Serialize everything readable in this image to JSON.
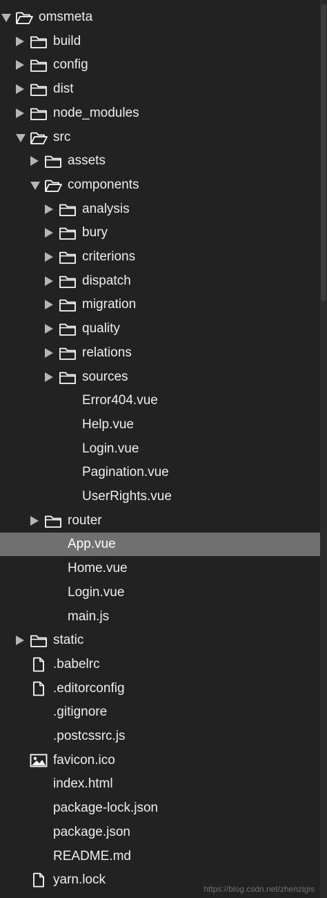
{
  "colors": {
    "background": "#222222",
    "text": "#eeeeee",
    "selection": "#707070",
    "arrow": "#b5b5b5",
    "icon": "#ffffff"
  },
  "tree": [
    {
      "label": "omsmeta",
      "depth": 0,
      "kind": "folder",
      "state": "expanded"
    },
    {
      "label": "build",
      "depth": 1,
      "kind": "folder",
      "state": "collapsed"
    },
    {
      "label": "config",
      "depth": 1,
      "kind": "folder",
      "state": "collapsed"
    },
    {
      "label": "dist",
      "depth": 1,
      "kind": "folder",
      "state": "collapsed"
    },
    {
      "label": "node_modules",
      "depth": 1,
      "kind": "folder",
      "state": "collapsed"
    },
    {
      "label": "src",
      "depth": 1,
      "kind": "folder",
      "state": "expanded"
    },
    {
      "label": "assets",
      "depth": 2,
      "kind": "folder",
      "state": "collapsed"
    },
    {
      "label": "components",
      "depth": 2,
      "kind": "folder",
      "state": "expanded"
    },
    {
      "label": "analysis",
      "depth": 3,
      "kind": "folder",
      "state": "collapsed"
    },
    {
      "label": "bury",
      "depth": 3,
      "kind": "folder",
      "state": "collapsed"
    },
    {
      "label": "criterions",
      "depth": 3,
      "kind": "folder",
      "state": "collapsed"
    },
    {
      "label": "dispatch",
      "depth": 3,
      "kind": "folder",
      "state": "collapsed"
    },
    {
      "label": "migration",
      "depth": 3,
      "kind": "folder",
      "state": "collapsed"
    },
    {
      "label": "quality",
      "depth": 3,
      "kind": "folder",
      "state": "collapsed"
    },
    {
      "label": "relations",
      "depth": 3,
      "kind": "folder",
      "state": "collapsed"
    },
    {
      "label": "sources",
      "depth": 3,
      "kind": "folder",
      "state": "collapsed"
    },
    {
      "label": "Error404.vue",
      "depth": 3,
      "kind": "file",
      "icon": "none"
    },
    {
      "label": "Help.vue",
      "depth": 3,
      "kind": "file",
      "icon": "none"
    },
    {
      "label": "Login.vue",
      "depth": 3,
      "kind": "file",
      "icon": "none"
    },
    {
      "label": "Pagination.vue",
      "depth": 3,
      "kind": "file",
      "icon": "none"
    },
    {
      "label": "UserRights.vue",
      "depth": 3,
      "kind": "file",
      "icon": "none"
    },
    {
      "label": "router",
      "depth": 2,
      "kind": "folder",
      "state": "collapsed"
    },
    {
      "label": "App.vue",
      "depth": 2,
      "kind": "file",
      "icon": "none",
      "selected": true
    },
    {
      "label": "Home.vue",
      "depth": 2,
      "kind": "file",
      "icon": "none"
    },
    {
      "label": "Login.vue",
      "depth": 2,
      "kind": "file",
      "icon": "none"
    },
    {
      "label": "main.js",
      "depth": 2,
      "kind": "file",
      "icon": "none"
    },
    {
      "label": "static",
      "depth": 1,
      "kind": "folder",
      "state": "collapsed"
    },
    {
      "label": ".babelrc",
      "depth": 1,
      "kind": "file",
      "icon": "document-icon"
    },
    {
      "label": ".editorconfig",
      "depth": 1,
      "kind": "file",
      "icon": "document-icon"
    },
    {
      "label": ".gitignore",
      "depth": 1,
      "kind": "file",
      "icon": "none"
    },
    {
      "label": ".postcssrc.js",
      "depth": 1,
      "kind": "file",
      "icon": "none"
    },
    {
      "label": "favicon.ico",
      "depth": 1,
      "kind": "file",
      "icon": "image-icon"
    },
    {
      "label": "index.html",
      "depth": 1,
      "kind": "file",
      "icon": "none"
    },
    {
      "label": "package-lock.json",
      "depth": 1,
      "kind": "file",
      "icon": "none"
    },
    {
      "label": "package.json",
      "depth": 1,
      "kind": "file",
      "icon": "none"
    },
    {
      "label": "README.md",
      "depth": 1,
      "kind": "file",
      "icon": "none"
    },
    {
      "label": "yarn.lock",
      "depth": 1,
      "kind": "file",
      "icon": "document-icon"
    }
  ],
  "watermark": "https://blog.csdn.net/zhenzigis"
}
